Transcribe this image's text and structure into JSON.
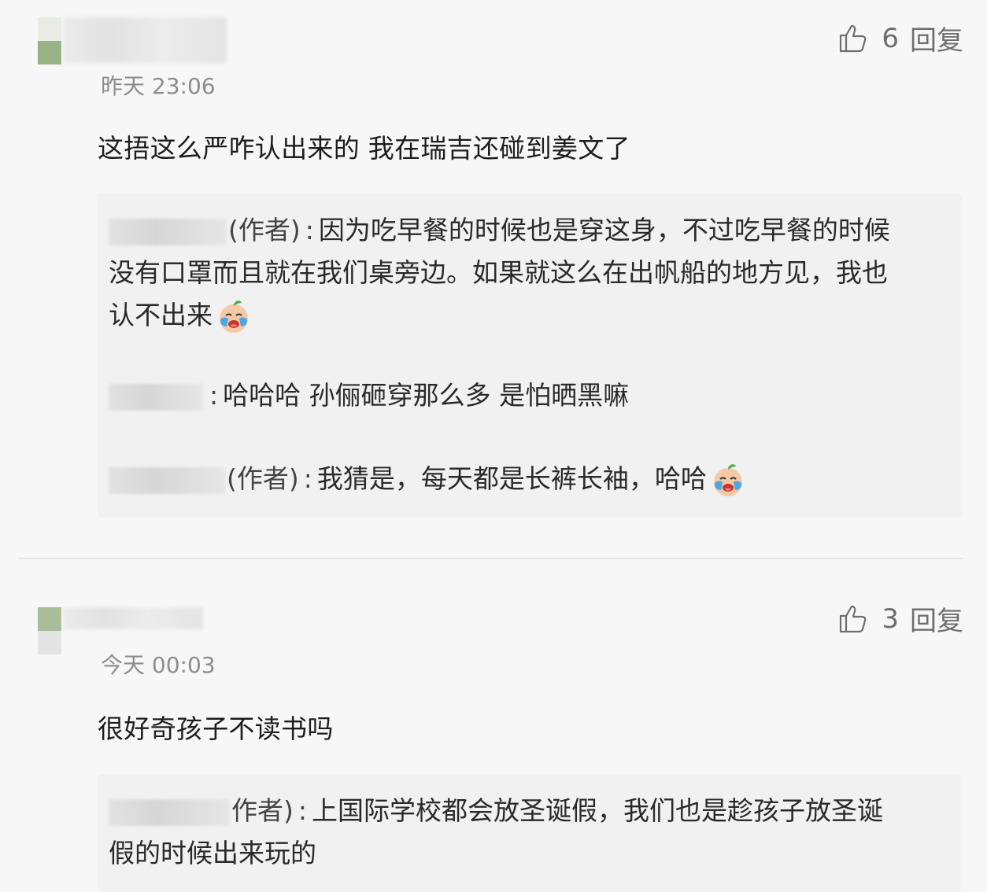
{
  "comments": [
    {
      "likes": "6",
      "reply_label": "回复",
      "time": "昨天 23:06",
      "text": "这捂这么严咋认出来的 我在瑞吉还碰到姜文了",
      "replies": [
        {
          "tag": "(作者)",
          "text": "因为吃早餐的时候也是穿这身，不过吃早餐的时候",
          "cont": "没有口罩而且就在我们桌旁边。如果就这么在出帆船的地方见，我也",
          "cont2": "认不出来",
          "emoji": "crying-baby-emoji"
        },
        {
          "tag": "",
          "text": "哈哈哈 孙俪砸穿那么多 是怕晒黑嘛"
        },
        {
          "tag": "(作者)",
          "text": "我猜是，每天都是长裤长袖，哈哈",
          "emoji": "crying-baby-emoji"
        }
      ]
    },
    {
      "likes": "3",
      "reply_label": "回复",
      "time": "今天 00:03",
      "text": "很好奇孩子不读书吗",
      "replies": [
        {
          "tag": "作者)",
          "text": "上国际学校都会放圣诞假，我们也是趁孩子放圣诞",
          "cont": "假的时候出来玩的"
        }
      ]
    }
  ],
  "colors": {
    "avatar_green": "#97b386",
    "meta_gray": "#6e6e6e",
    "time_gray": "#8c8c8c",
    "reply_bg": "#f1f1f1"
  },
  "icons": {
    "like": "thumbs-up-icon",
    "emoji": "crying-baby-emoji"
  }
}
